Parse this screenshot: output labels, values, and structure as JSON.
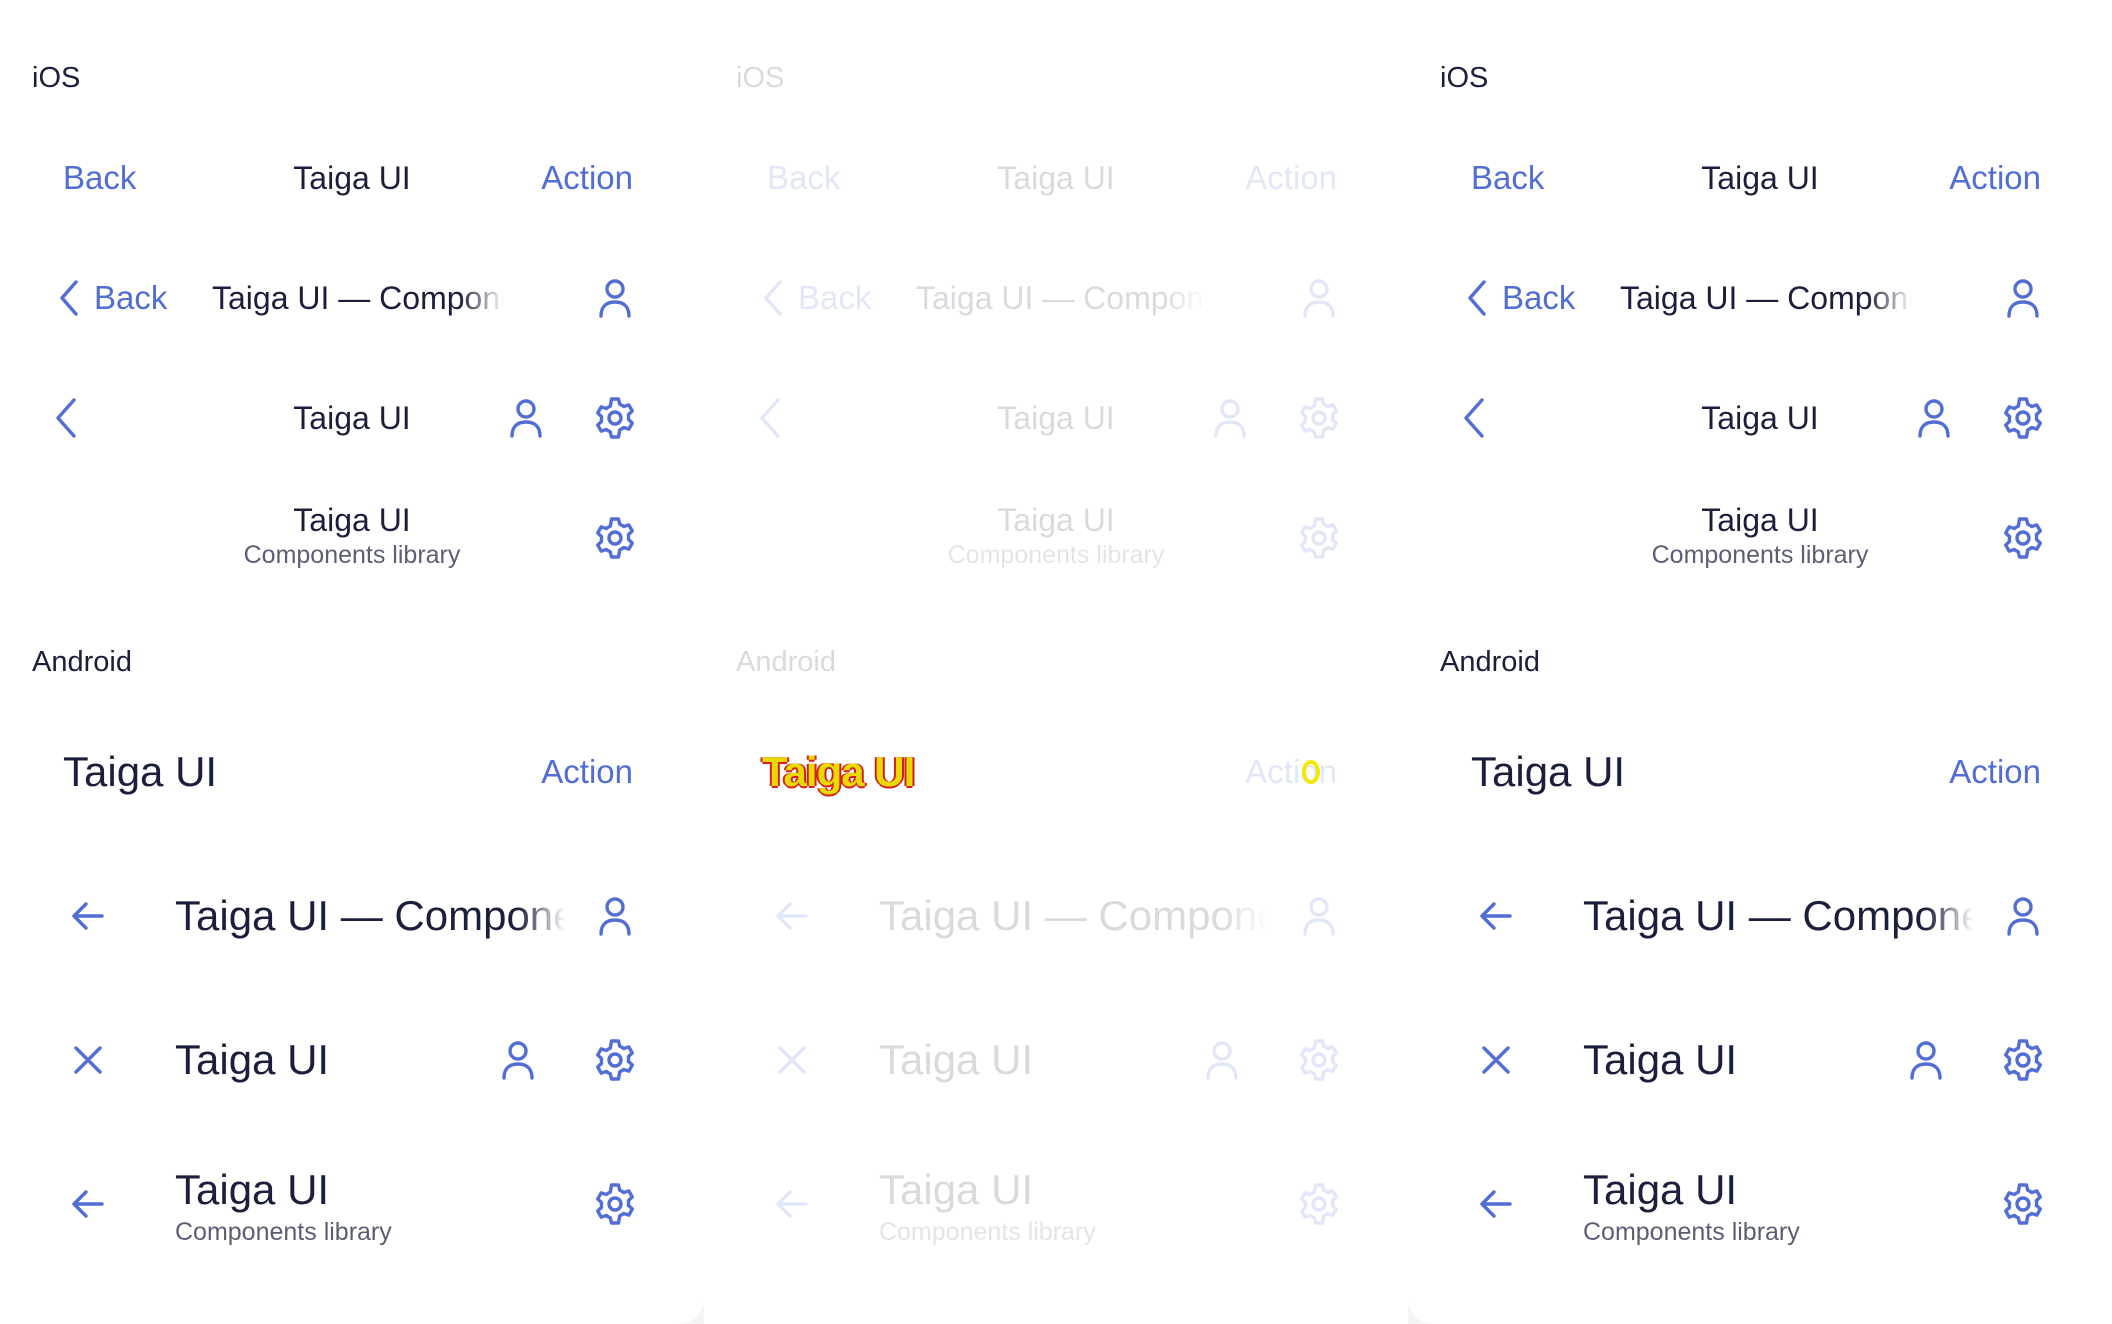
{
  "colors": {
    "accent": "#526ed3",
    "text": "#1b1f3b",
    "secondary": "#5c5f73",
    "background": "#ffffff"
  },
  "panels": [
    {
      "state": "normal",
      "ios_label": "iOS",
      "android_label": "Android",
      "ios": {
        "bar1": {
          "back": "Back",
          "title": "Taiga UI",
          "action": "Action"
        },
        "bar2": {
          "back": "Back",
          "title": "Taiga UI — Components library"
        },
        "bar3": {
          "title": "Taiga UI"
        },
        "bar4": {
          "title": "Taiga UI",
          "subtitle": "Components library"
        }
      },
      "android": {
        "bar1": {
          "title": "Taiga UI",
          "action": "Action"
        },
        "bar2": {
          "title": "Taiga UI — Components library"
        },
        "bar3": {
          "title": "Taiga UI"
        },
        "bar4": {
          "title": "Taiga UI",
          "subtitle": "Components library"
        }
      }
    },
    {
      "state": "disabled",
      "ios_label": "iOS",
      "android_label": "Android",
      "ios": {
        "bar1": {
          "back": "Back",
          "title": "Taiga UI",
          "action": "Action"
        },
        "bar2": {
          "back": "Back",
          "title": "Taiga UI — Components library"
        },
        "bar3": {
          "title": "Taiga UI"
        },
        "bar4": {
          "title": "Taiga UI",
          "subtitle": "Components library"
        }
      },
      "android": {
        "bar1": {
          "title": "Taiga UI",
          "action": "Action"
        },
        "bar2": {
          "title": "Taiga UI — Components library"
        },
        "bar3": {
          "title": "Taiga UI"
        },
        "bar4": {
          "title": "Taiga UI",
          "subtitle": "Components library"
        }
      }
    },
    {
      "state": "normal",
      "ios_label": "iOS",
      "android_label": "Android",
      "ios": {
        "bar1": {
          "back": "Back",
          "title": "Taiga UI",
          "action": "Action"
        },
        "bar2": {
          "back": "Back",
          "title": "Taiga UI — Components library"
        },
        "bar3": {
          "title": "Taiga UI"
        },
        "bar4": {
          "title": "Taiga UI",
          "subtitle": "Components library"
        }
      },
      "android": {
        "bar1": {
          "title": "Taiga UI",
          "action": "Action"
        },
        "bar2": {
          "title": "Taiga UI — Components library"
        },
        "bar3": {
          "title": "Taiga UI"
        },
        "bar4": {
          "title": "Taiga UI",
          "subtitle": "Components library"
        }
      }
    }
  ],
  "icons": {
    "chevron_left": "chevron-left-icon",
    "arrow_left": "arrow-left-icon",
    "close": "close-icon",
    "user": "user-icon",
    "settings": "gear-icon"
  }
}
